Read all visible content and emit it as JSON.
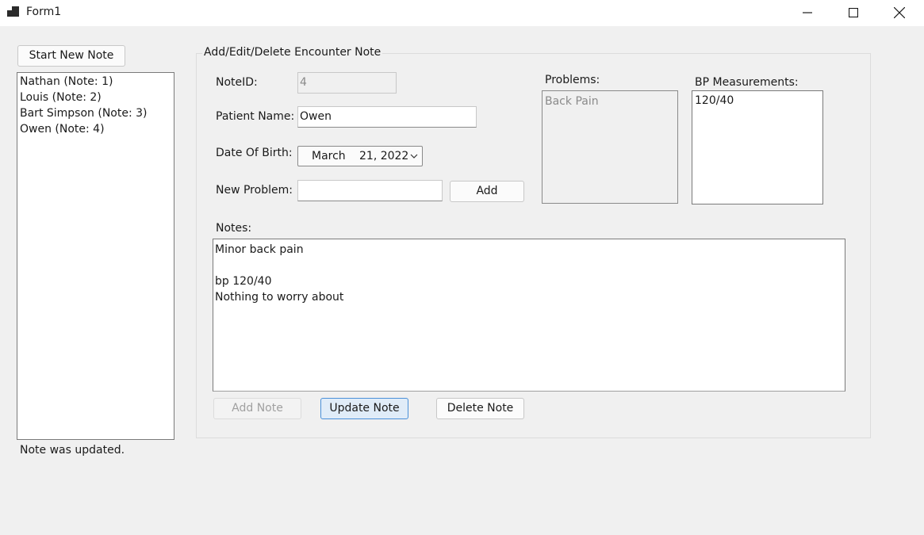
{
  "window": {
    "title": "Form1"
  },
  "sidebar": {
    "start_new_note_label": "Start New Note",
    "notes": [
      "Nathan (Note: 1)",
      "Louis (Note: 2)",
      "Bart Simpson (Note: 3)",
      "Owen (Note: 4)"
    ],
    "status": "Note was updated."
  },
  "form": {
    "group_title": "Add/Edit/Delete Encounter Note",
    "note_id_label": "NoteID:",
    "note_id_value": "4",
    "patient_name_label": "Patient Name:",
    "patient_name_value": "Owen",
    "dob_label": "Date Of Birth:",
    "dob_month": "March",
    "dob_day_year": "21, 2022",
    "new_problem_label": "New Problem:",
    "new_problem_value": "",
    "add_label": "Add",
    "problems_label": "Problems:",
    "problems": [
      "Back Pain"
    ],
    "bp_label": "BP Measurements:",
    "bp_measurements": [
      "120/40"
    ],
    "notes_label": "Notes:",
    "notes_text": "Minor back pain\n\nbp 120/40\nNothing to worry about",
    "add_note_label": "Add Note",
    "update_note_label": "Update Note",
    "delete_note_label": "Delete Note"
  }
}
